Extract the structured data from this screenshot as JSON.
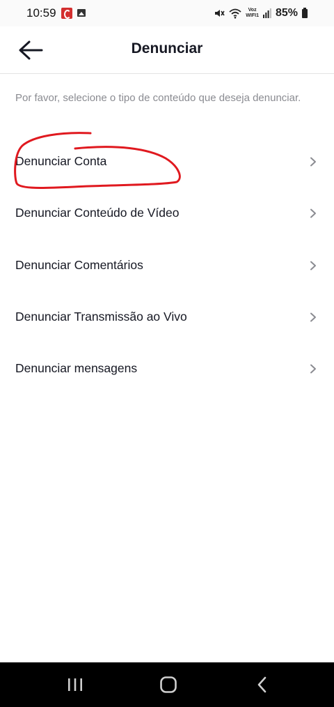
{
  "status_bar": {
    "time": "10:59",
    "voz_wifi_top": "Voz",
    "voz_wifi_bottom": "WIFI1",
    "battery": "85%"
  },
  "header": {
    "title": "Denunciar"
  },
  "subtitle": "Por favor, selecione o tipo de conteúdo que deseja denunciar.",
  "menu": [
    {
      "label": "Denunciar Conta"
    },
    {
      "label": "Denunciar Conteúdo de Vídeo"
    },
    {
      "label": "Denunciar Comentários"
    },
    {
      "label": "Denunciar Transmissão ao Vivo"
    },
    {
      "label": "Denunciar mensagens"
    }
  ],
  "colors": {
    "annotation": "#e0191f",
    "text_primary": "#161823",
    "text_secondary": "#8a8b91",
    "nav_bar": "#000000"
  },
  "icons": {
    "back": "arrow-left-icon",
    "chevron": "chevron-right-icon",
    "nav_recents": "recents-icon",
    "nav_home": "home-icon",
    "nav_back": "nav-back-icon"
  }
}
